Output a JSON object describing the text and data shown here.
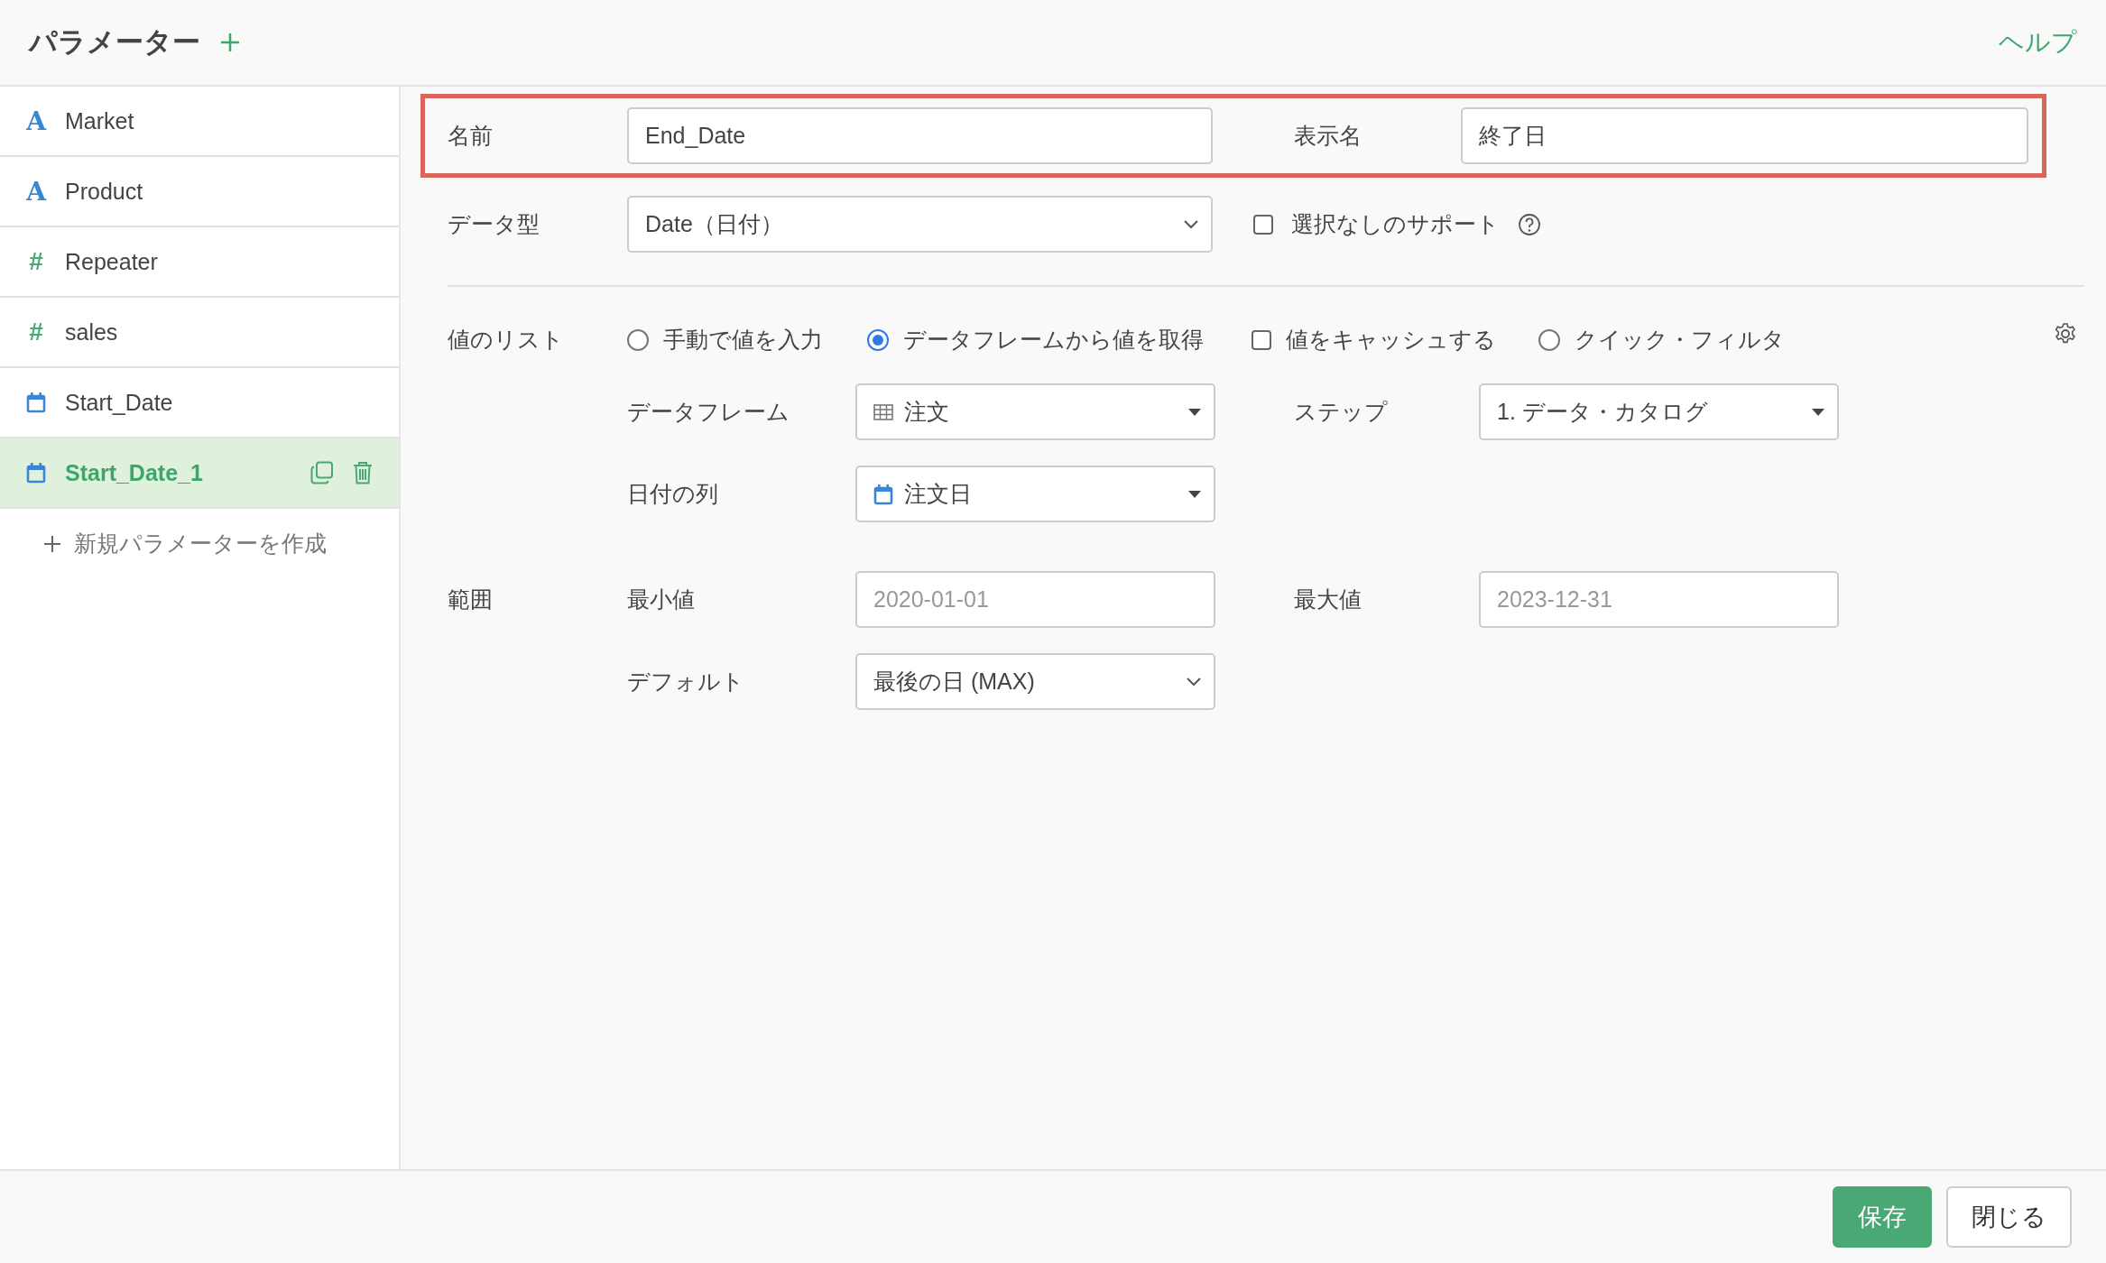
{
  "header": {
    "title": "パラメーター",
    "help": "ヘルプ"
  },
  "sidebar": {
    "items": [
      {
        "label": "Market",
        "kind": "text",
        "icon": "A",
        "selected": false
      },
      {
        "label": "Product",
        "kind": "text",
        "icon": "A",
        "selected": false
      },
      {
        "label": "Repeater",
        "kind": "number",
        "icon": "#",
        "selected": false
      },
      {
        "label": "sales",
        "kind": "number",
        "icon": "#",
        "selected": false
      },
      {
        "label": "Start_Date",
        "kind": "date",
        "selected": false
      },
      {
        "label": "Start_Date_1",
        "kind": "date",
        "selected": true
      }
    ],
    "new_item": "新規パラメーターを作成"
  },
  "form": {
    "name": {
      "label": "名前",
      "value": "End_Date"
    },
    "display_name": {
      "label": "表示名",
      "value": "終了日"
    },
    "data_type": {
      "label": "データ型",
      "value": "Date（日付）"
    },
    "support_none": {
      "label": "選択なしのサポート",
      "checked": false
    },
    "value_list": {
      "label": "値のリスト",
      "options": [
        {
          "kind": "radio",
          "label": "手動で値を入力",
          "selected": false
        },
        {
          "kind": "radio",
          "label": "データフレームから値を取得",
          "selected": true
        },
        {
          "kind": "checkbox",
          "label": "値をキャッシュする",
          "checked": false
        },
        {
          "kind": "radio",
          "label": "クイック・フィルタ",
          "selected": false
        }
      ]
    },
    "dataframe": {
      "label": "データフレーム",
      "value": "注文"
    },
    "step": {
      "label": "ステップ",
      "value": "1. データ・カタログ"
    },
    "date_column": {
      "label": "日付の列",
      "value": "注文日"
    },
    "range": {
      "label": "範囲"
    },
    "min": {
      "label": "最小値",
      "placeholder": "2020-01-01"
    },
    "max": {
      "label": "最大値",
      "placeholder": "2023-12-31"
    },
    "default": {
      "label": "デフォルト",
      "value": "最後の日 (MAX)"
    }
  },
  "footer": {
    "buttons": [
      {
        "kind": "primary",
        "label": "保存"
      },
      {
        "kind": "secondary",
        "label": "閉じる"
      }
    ]
  }
}
